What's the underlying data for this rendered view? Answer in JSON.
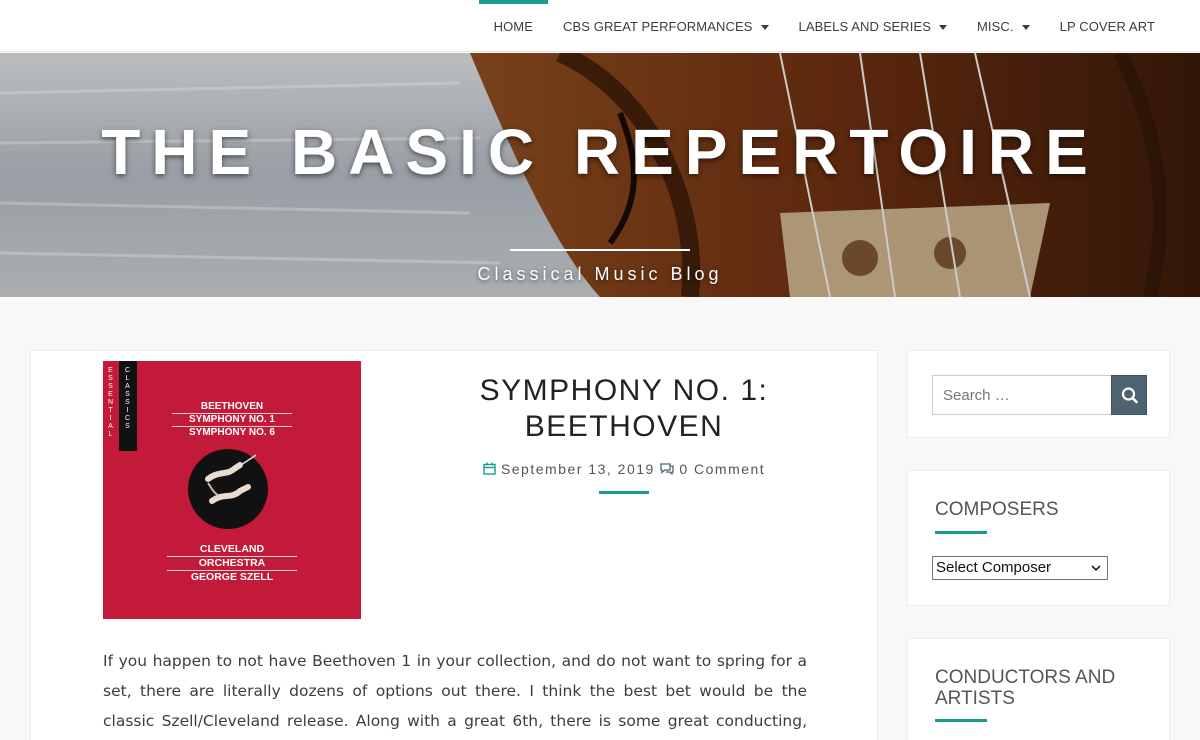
{
  "nav": {
    "items": [
      {
        "label": "HOME",
        "active": true,
        "has_dropdown": false
      },
      {
        "label": "CBS GREAT PERFORMANCES",
        "active": false,
        "has_dropdown": true
      },
      {
        "label": "LABELS AND SERIES",
        "active": false,
        "has_dropdown": true
      },
      {
        "label": "MISC.",
        "active": false,
        "has_dropdown": true
      },
      {
        "label": "LP COVER ART",
        "active": false,
        "has_dropdown": false
      }
    ]
  },
  "header": {
    "title": "THE BASIC REPERTOIRE",
    "tagline": "Classical Music Blog"
  },
  "post": {
    "title_line1": "SYMPHONY NO. 1:",
    "title_line2": "BEETHOVEN",
    "date": "September 13, 2019",
    "comments": "0 Comment",
    "album": {
      "series_vertical_1": "ESSENTIAL",
      "series_vertical_2": "CLASSICS",
      "line1": "BEETHOVEN",
      "line2": "SYMPHONY NO. 1",
      "line3": "SYMPHONY NO. 6",
      "bottom1": "CLEVELAND",
      "bottom2": "ORCHESTRA",
      "bottom3": "GEORGE SZELL"
    },
    "body": "If you happen to not have Beethoven 1 in your collection, and do not want to spring for a set, there are literally dozens of options out there. I think the best bet would be the classic Szell/Cleveland release. Along with a great 6th, there is some great conducting, good energy"
  },
  "sidebar": {
    "search_placeholder": "Search …",
    "composers_title": "COMPOSERS",
    "composer_select": "Select Composer",
    "conductors_title_line1": "CONDUCTORS AND",
    "conductors_title_line2": "ARTISTS"
  },
  "colors": {
    "accent": "#1c9a90",
    "album_red": "#c41a3a",
    "search_button": "#4d6372"
  }
}
